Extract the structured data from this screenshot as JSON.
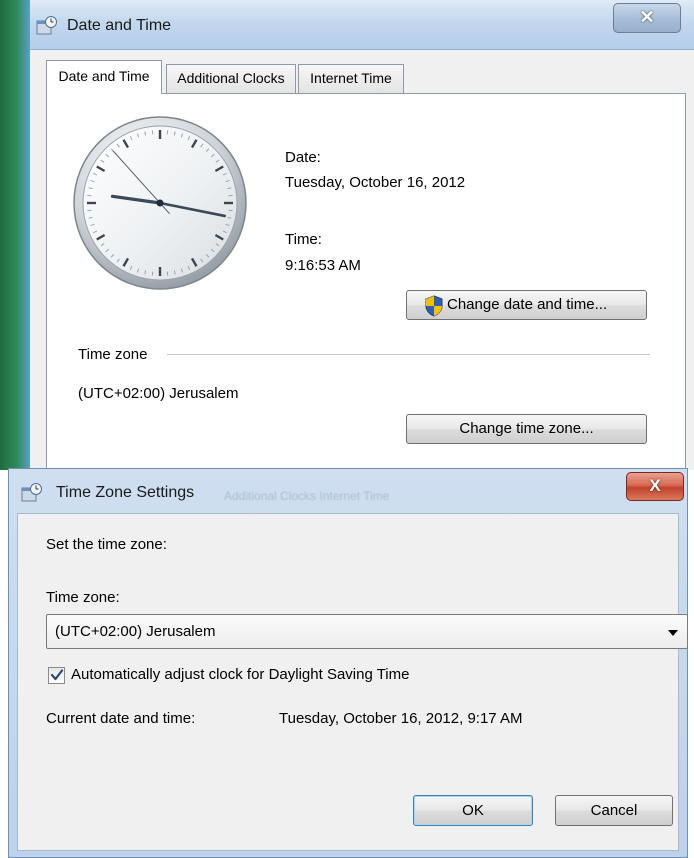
{
  "date_time_window": {
    "title": "Date and Time",
    "close_glyph": "✕",
    "tabs": [
      {
        "label": "Date and Time",
        "active": true
      },
      {
        "label": "Additional Clocks",
        "active": false
      },
      {
        "label": "Internet Time",
        "active": false
      }
    ],
    "date_label": "Date:",
    "date_value": "Tuesday, October 16, 2012",
    "time_label": "Time:",
    "time_value": "9:16:53 AM",
    "change_datetime_button": "Change date and time...",
    "time_zone_heading": "Time zone",
    "time_zone_value": "(UTC+02:00) Jerusalem",
    "change_timezone_button": "Change time zone...",
    "clock": {
      "hours": 9,
      "minutes": 16,
      "seconds": 53
    }
  },
  "time_zone_window": {
    "title": "Time Zone Settings",
    "ghost_text": "Additional Clocks   Internet Time",
    "close_glyph": "X",
    "instruction": "Set the time zone:",
    "time_zone_label": "Time zone:",
    "selected_time_zone": "(UTC+02:00) Jerusalem",
    "dst_checkbox_label": "Automatically adjust clock for Daylight Saving Time",
    "dst_checked": true,
    "current_label": "Current date and time:",
    "current_value": "Tuesday, October 16, 2012, 9:17 AM",
    "ok_button": "OK",
    "cancel_button": "Cancel"
  },
  "colors": {
    "title_bar": "#c3d8ee",
    "close_red": "#c2412a",
    "window_bg": "#f0f0f0",
    "shield_blue": "#2f5fb3",
    "shield_yellow": "#f2c200"
  },
  "icons": [
    "date-time-app-icon",
    "close-icon",
    "uac-shield-icon",
    "dropdown-arrow-icon",
    "check-icon"
  ]
}
